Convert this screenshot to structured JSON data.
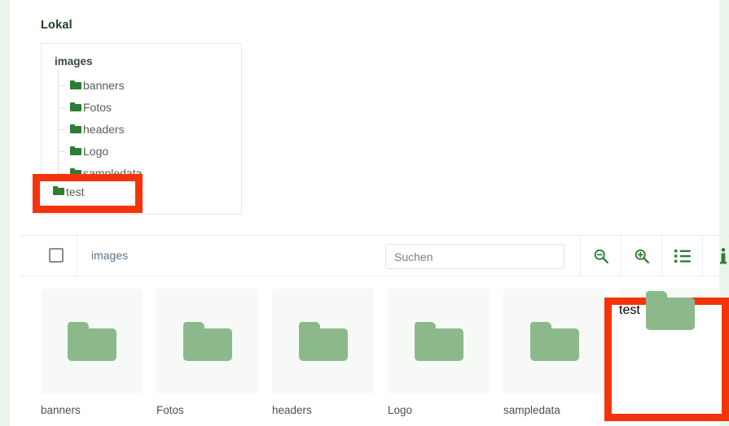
{
  "section": {
    "local_title": "Lokal"
  },
  "tree": {
    "root_label": "images",
    "items": [
      {
        "label": "banners",
        "icon": "folder-icon"
      },
      {
        "label": "Fotos",
        "icon": "folder-icon"
      },
      {
        "label": "headers",
        "icon": "folder-icon"
      },
      {
        "label": "Logo",
        "icon": "folder-icon"
      },
      {
        "label": "sampledata",
        "icon": "folder-icon"
      },
      {
        "label": "test",
        "icon": "folder-icon"
      }
    ]
  },
  "toolbar": {
    "checkbox_checked": false,
    "breadcrumb": "images",
    "search_placeholder": "Suchen",
    "search_value": "",
    "buttons": [
      {
        "name": "zoom-out",
        "icon": "magnifier-minus-icon"
      },
      {
        "name": "zoom-in",
        "icon": "magnifier-plus-icon"
      },
      {
        "name": "list-view",
        "icon": "list-icon"
      },
      {
        "name": "info",
        "icon": "info-icon"
      }
    ]
  },
  "grid": {
    "tiles": [
      {
        "label": "banners",
        "icon": "folder-icon",
        "highlighted": false
      },
      {
        "label": "Fotos",
        "icon": "folder-icon",
        "highlighted": false
      },
      {
        "label": "headers",
        "icon": "folder-icon",
        "highlighted": false
      },
      {
        "label": "Logo",
        "icon": "folder-icon",
        "highlighted": false
      },
      {
        "label": "sampledata",
        "icon": "folder-icon",
        "highlighted": false
      },
      {
        "label": "test",
        "icon": "folder-icon",
        "highlighted": true
      }
    ]
  },
  "colors": {
    "page_background": "#eaf4ea",
    "panel": "#ffffff",
    "tree_folder": "#2e7d32",
    "tile_folder": "#8cb98c",
    "tile_background": "#f6f9f6",
    "accent_icon": "#2f7d32",
    "breadcrumb_link": "#5b7187",
    "annotation": "#f5330a",
    "title_text": "#23401f"
  }
}
